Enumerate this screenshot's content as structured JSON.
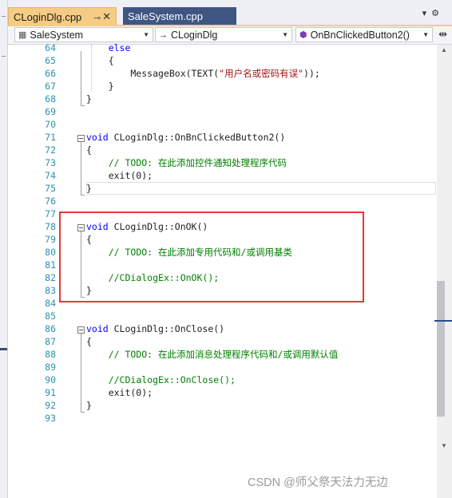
{
  "tabs": [
    {
      "label": "CLoginDlg.cpp",
      "active": true,
      "pin_icon": "pin-icon",
      "close_icon": "close-icon"
    },
    {
      "label": "SaleSystem.cpp",
      "active": false
    }
  ],
  "tabbar_controls": [
    "dropdown-icon",
    "settings-icon"
  ],
  "nav": {
    "project": "SaleSystem",
    "scope": "CLoginDlg",
    "member": "OnBnClickedButton2()"
  },
  "lines": [
    {
      "n": "64",
      "parts": [
        {
          "t": "    ",
          "c": ""
        },
        {
          "t": "else",
          "c": "kw"
        }
      ]
    },
    {
      "n": "65",
      "parts": [
        {
          "t": "    {",
          "c": ""
        }
      ]
    },
    {
      "n": "66",
      "parts": [
        {
          "t": "        MessageBox(TEXT(",
          "c": ""
        },
        {
          "t": "\"用户名或密码有误\"",
          "c": "st"
        },
        {
          "t": "));",
          "c": ""
        }
      ]
    },
    {
      "n": "67",
      "parts": [
        {
          "t": "    }",
          "c": ""
        }
      ]
    },
    {
      "n": "68",
      "parts": [
        {
          "t": "}",
          "c": ""
        }
      ]
    },
    {
      "n": "69",
      "parts": []
    },
    {
      "n": "70",
      "parts": []
    },
    {
      "n": "71",
      "parts": [
        {
          "t": "void",
          "c": "kw"
        },
        {
          "t": " CLoginDlg::OnBnClickedButton2()",
          "c": ""
        }
      ]
    },
    {
      "n": "72",
      "parts": [
        {
          "t": "{",
          "c": ""
        }
      ]
    },
    {
      "n": "73",
      "parts": [
        {
          "t": "    ",
          "c": ""
        },
        {
          "t": "// TODO: 在此添加控件通知处理程序代码",
          "c": "cm"
        }
      ]
    },
    {
      "n": "74",
      "parts": [
        {
          "t": "    exit(0);",
          "c": ""
        }
      ]
    },
    {
      "n": "75",
      "parts": [
        {
          "t": "}",
          "c": ""
        }
      ]
    },
    {
      "n": "76",
      "parts": []
    },
    {
      "n": "77",
      "parts": []
    },
    {
      "n": "78",
      "parts": [
        {
          "t": "void",
          "c": "kw"
        },
        {
          "t": " CLoginDlg::OnOK()",
          "c": ""
        }
      ]
    },
    {
      "n": "79",
      "parts": [
        {
          "t": "{",
          "c": ""
        }
      ]
    },
    {
      "n": "80",
      "parts": [
        {
          "t": "    ",
          "c": ""
        },
        {
          "t": "// TODO: 在此添加专用代码和/或调用基类",
          "c": "cm"
        }
      ]
    },
    {
      "n": "81",
      "parts": []
    },
    {
      "n": "82",
      "parts": [
        {
          "t": "    ",
          "c": ""
        },
        {
          "t": "//CDialogEx::OnOK();",
          "c": "cm"
        }
      ]
    },
    {
      "n": "83",
      "parts": [
        {
          "t": "}",
          "c": ""
        }
      ]
    },
    {
      "n": "84",
      "parts": []
    },
    {
      "n": "85",
      "parts": []
    },
    {
      "n": "86",
      "parts": [
        {
          "t": "void",
          "c": "kw"
        },
        {
          "t": " CLoginDlg::OnClose()",
          "c": ""
        }
      ]
    },
    {
      "n": "87",
      "parts": [
        {
          "t": "{",
          "c": ""
        }
      ]
    },
    {
      "n": "88",
      "parts": [
        {
          "t": "    ",
          "c": ""
        },
        {
          "t": "// TODO: 在此添加消息处理程序代码和/或调用默认值",
          "c": "cm"
        }
      ]
    },
    {
      "n": "89",
      "parts": []
    },
    {
      "n": "90",
      "parts": [
        {
          "t": "    ",
          "c": ""
        },
        {
          "t": "//CDialogEx::OnClose();",
          "c": "cm"
        }
      ]
    },
    {
      "n": "91",
      "parts": [
        {
          "t": "    exit(0);",
          "c": ""
        }
      ]
    },
    {
      "n": "92",
      "parts": [
        {
          "t": "}",
          "c": ""
        }
      ]
    },
    {
      "n": "93",
      "parts": []
    }
  ],
  "watermark": "CSDN @师父祭天法力无边",
  "colors": {
    "keyword": "#0000ff",
    "comment": "#008000",
    "string": "#a31515",
    "line_number": "#2b91af",
    "active_tab": "#f5cc84",
    "inactive_tab": "#3f5683",
    "highlight_box": "#e53935"
  }
}
